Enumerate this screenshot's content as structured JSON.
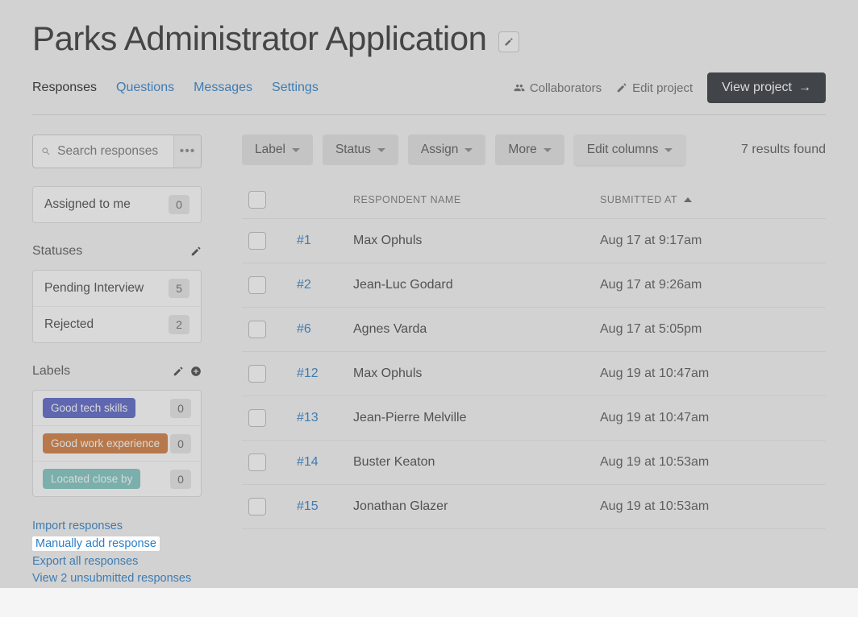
{
  "page_title": "Parks Administrator Application",
  "tabs": {
    "responses": "Responses",
    "questions": "Questions",
    "messages": "Messages",
    "settings": "Settings"
  },
  "header_actions": {
    "collaborators": "Collaborators",
    "edit_project": "Edit project",
    "view_project": "View project"
  },
  "search": {
    "placeholder": "Search responses"
  },
  "assigned": {
    "label": "Assigned to me",
    "count": "0"
  },
  "statuses": {
    "heading": "Statuses",
    "items": [
      {
        "label": "Pending Interview",
        "count": "5"
      },
      {
        "label": "Rejected",
        "count": "2"
      }
    ]
  },
  "labels": {
    "heading": "Labels",
    "items": [
      {
        "label": "Good tech skills",
        "color": "#5661c7",
        "count": "0"
      },
      {
        "label": "Good work experience",
        "color": "#d07a3b",
        "count": "0"
      },
      {
        "label": "Located close by",
        "color": "#7cc5c1",
        "count": "0"
      }
    ]
  },
  "footer_links": {
    "import": "Import responses",
    "manual": "Manually add response",
    "export": "Export all responses",
    "view_unsub": "View 2 unsubmitted responses"
  },
  "toolbar": {
    "label": "Label",
    "status": "Status",
    "assign": "Assign",
    "more": "More",
    "edit_columns": "Edit columns"
  },
  "results_found": "7 results found",
  "columns": {
    "respondent": "RESPONDENT NAME",
    "submitted": "SUBMITTED AT"
  },
  "rows": [
    {
      "id": "#1",
      "name": "Max Ophuls",
      "submitted": "Aug 17 at 9:17am"
    },
    {
      "id": "#2",
      "name": "Jean-Luc Godard",
      "submitted": "Aug 17 at 9:26am"
    },
    {
      "id": "#6",
      "name": "Agnes Varda",
      "submitted": "Aug 17 at 5:05pm"
    },
    {
      "id": "#12",
      "name": "Max Ophuls",
      "submitted": "Aug 19 at 10:47am"
    },
    {
      "id": "#13",
      "name": "Jean-Pierre Melville",
      "submitted": "Aug 19 at 10:47am"
    },
    {
      "id": "#14",
      "name": "Buster Keaton",
      "submitted": "Aug 19 at 10:53am"
    },
    {
      "id": "#15",
      "name": "Jonathan Glazer",
      "submitted": "Aug 19 at 10:53am"
    }
  ]
}
